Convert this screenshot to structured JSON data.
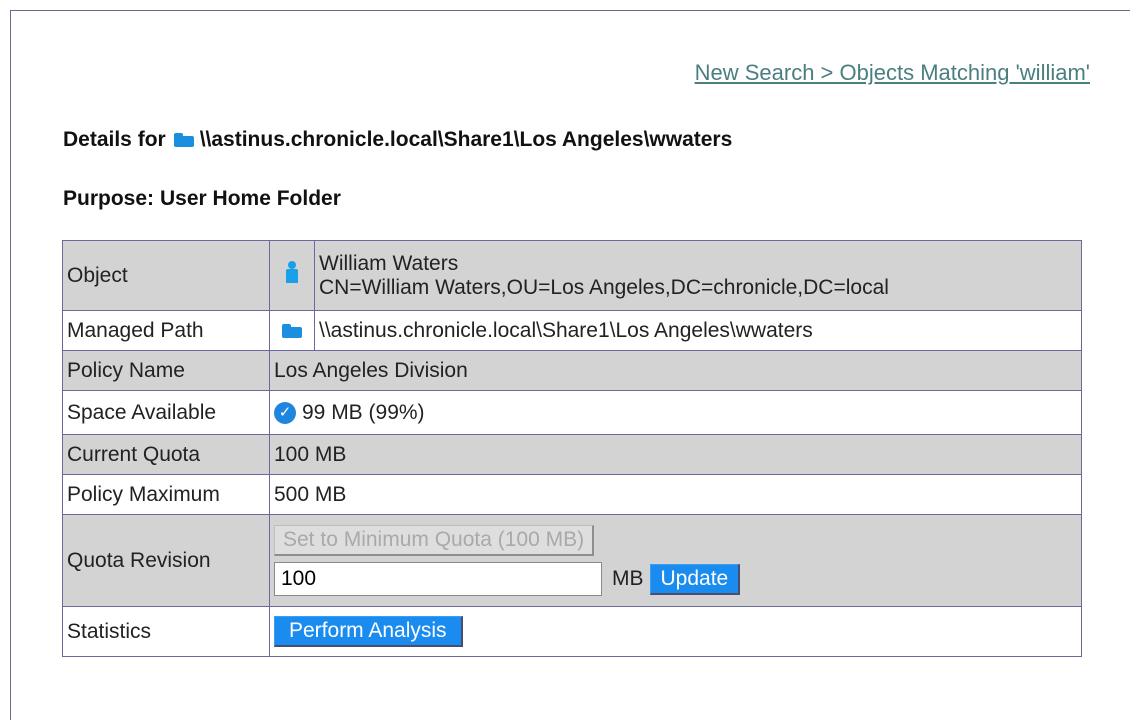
{
  "breadcrumb": {
    "new_search": "New Search",
    "separator": " > ",
    "current": "Objects Matching 'william'"
  },
  "details": {
    "prefix": "Details for",
    "path": "\\\\astinus.chronicle.local\\Share1\\Los Angeles\\wwaters",
    "folder_icon": "folder-icon"
  },
  "purpose": {
    "label": "Purpose:",
    "value": "User Home Folder"
  },
  "rows": {
    "object": {
      "label": "Object",
      "icon": "user-icon",
      "name": "William Waters",
      "dn": "CN=William Waters,OU=Los Angeles,DC=chronicle,DC=local"
    },
    "managed_path": {
      "label": "Managed Path",
      "icon": "folder-icon",
      "value": "\\\\astinus.chronicle.local\\Share1\\Los Angeles\\wwaters"
    },
    "policy_name": {
      "label": "Policy Name",
      "value": "Los Angeles Division"
    },
    "space_available": {
      "label": "Space Available",
      "icon": "check-circle-icon",
      "value": "99 MB (99%)"
    },
    "current_quota": {
      "label": "Current Quota",
      "value": "100 MB"
    },
    "policy_maximum": {
      "label": "Policy Maximum",
      "value": "500 MB"
    },
    "quota_revision": {
      "label": "Quota Revision",
      "min_button": "Set to Minimum Quota (100 MB)",
      "input_value": "100",
      "unit": "MB",
      "update_button": "Update"
    },
    "statistics": {
      "label": "Statistics",
      "button": "Perform Analysis"
    }
  },
  "colors": {
    "accent_button": "#1a8cf0",
    "icon_blue": "#1a8fe0",
    "link": "#4a7f80",
    "row_shade": "#d3d3d3",
    "border": "#6a6a9a"
  }
}
